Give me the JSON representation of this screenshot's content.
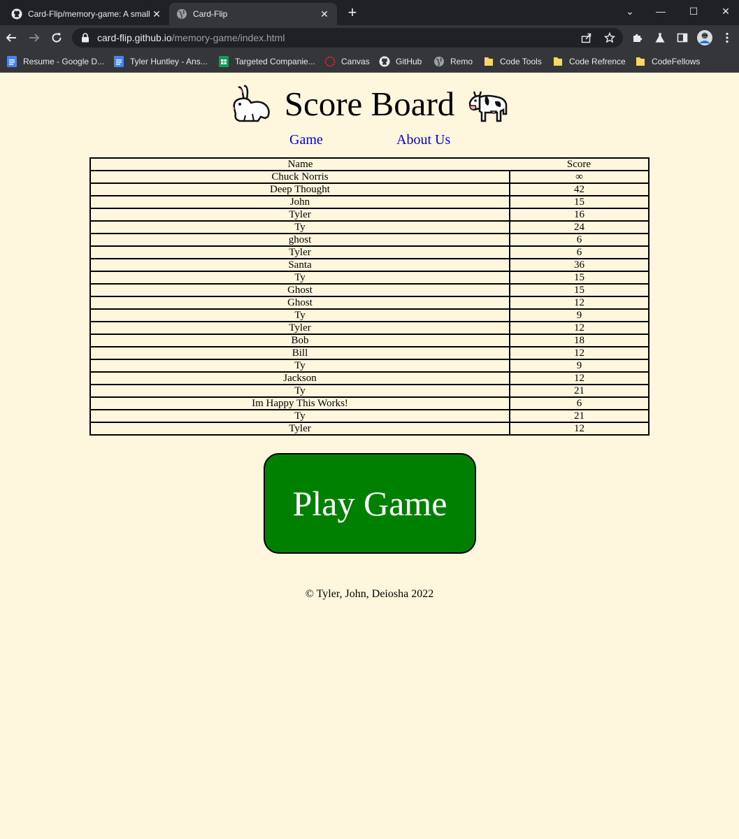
{
  "browser": {
    "tabs": [
      {
        "title": "Card-Flip/memory-game: A small",
        "icon": "github-icon",
        "active": false
      },
      {
        "title": "Card-Flip",
        "icon": "globe-icon",
        "active": true
      }
    ],
    "new_tab": "+",
    "window_controls": {
      "dropdown": "⌄",
      "minimize": "—",
      "maximize": "☐",
      "close": "✕"
    },
    "url_host": "card-flip.github.io",
    "url_path": "/memory-game/index.html",
    "bookmarks": [
      {
        "label": "Resume - Google D...",
        "icon": "google-docs-icon"
      },
      {
        "label": "Tyler Huntley - Ans...",
        "icon": "google-docs-icon"
      },
      {
        "label": "Targeted Companie...",
        "icon": "google-sheets-icon"
      },
      {
        "label": "Canvas",
        "icon": "canvas-icon"
      },
      {
        "label": "GitHub",
        "icon": "github-icon"
      },
      {
        "label": "Remo",
        "icon": "globe-icon"
      },
      {
        "label": "Code Tools",
        "icon": "folder-icon"
      },
      {
        "label": "Code Refrence",
        "icon": "folder-icon"
      },
      {
        "label": "CodeFellows",
        "icon": "folder-icon"
      }
    ]
  },
  "page": {
    "title": "Score Board",
    "left_emoji": "rabbit-icon",
    "right_emoji": "cow-icon",
    "nav": {
      "game": "Game",
      "about": "About Us"
    },
    "table": {
      "headers": {
        "name": "Name",
        "score": "Score"
      },
      "rows": [
        {
          "name": "Chuck Norris",
          "score": "∞"
        },
        {
          "name": "Deep Thought",
          "score": "42"
        },
        {
          "name": "John",
          "score": "15"
        },
        {
          "name": "Tyler",
          "score": "16"
        },
        {
          "name": "Ty",
          "score": "24"
        },
        {
          "name": "ghost",
          "score": "6"
        },
        {
          "name": "Tyler",
          "score": "6"
        },
        {
          "name": "Santa",
          "score": "36"
        },
        {
          "name": "Ty",
          "score": "15"
        },
        {
          "name": "Ghost",
          "score": "15"
        },
        {
          "name": "Ghost",
          "score": "12"
        },
        {
          "name": "Ty",
          "score": "9"
        },
        {
          "name": "Tyler",
          "score": "12"
        },
        {
          "name": "Bob",
          "score": "18"
        },
        {
          "name": "Bill",
          "score": "12"
        },
        {
          "name": "Ty",
          "score": "9"
        },
        {
          "name": "Jackson",
          "score": "12"
        },
        {
          "name": "Ty",
          "score": "21"
        },
        {
          "name": "Im Happy This Works!",
          "score": "6"
        },
        {
          "name": "Ty",
          "score": "21"
        },
        {
          "name": "Tyler",
          "score": "12"
        }
      ]
    },
    "play_button": "Play Game",
    "footer": "© Tyler, John, Deiosha 2022"
  },
  "colors": {
    "page_background": "#fff7dd",
    "link": "#0000ee",
    "play_button": "#008000",
    "chrome_dark": "#202124",
    "chrome_toolbar": "#35363a"
  }
}
